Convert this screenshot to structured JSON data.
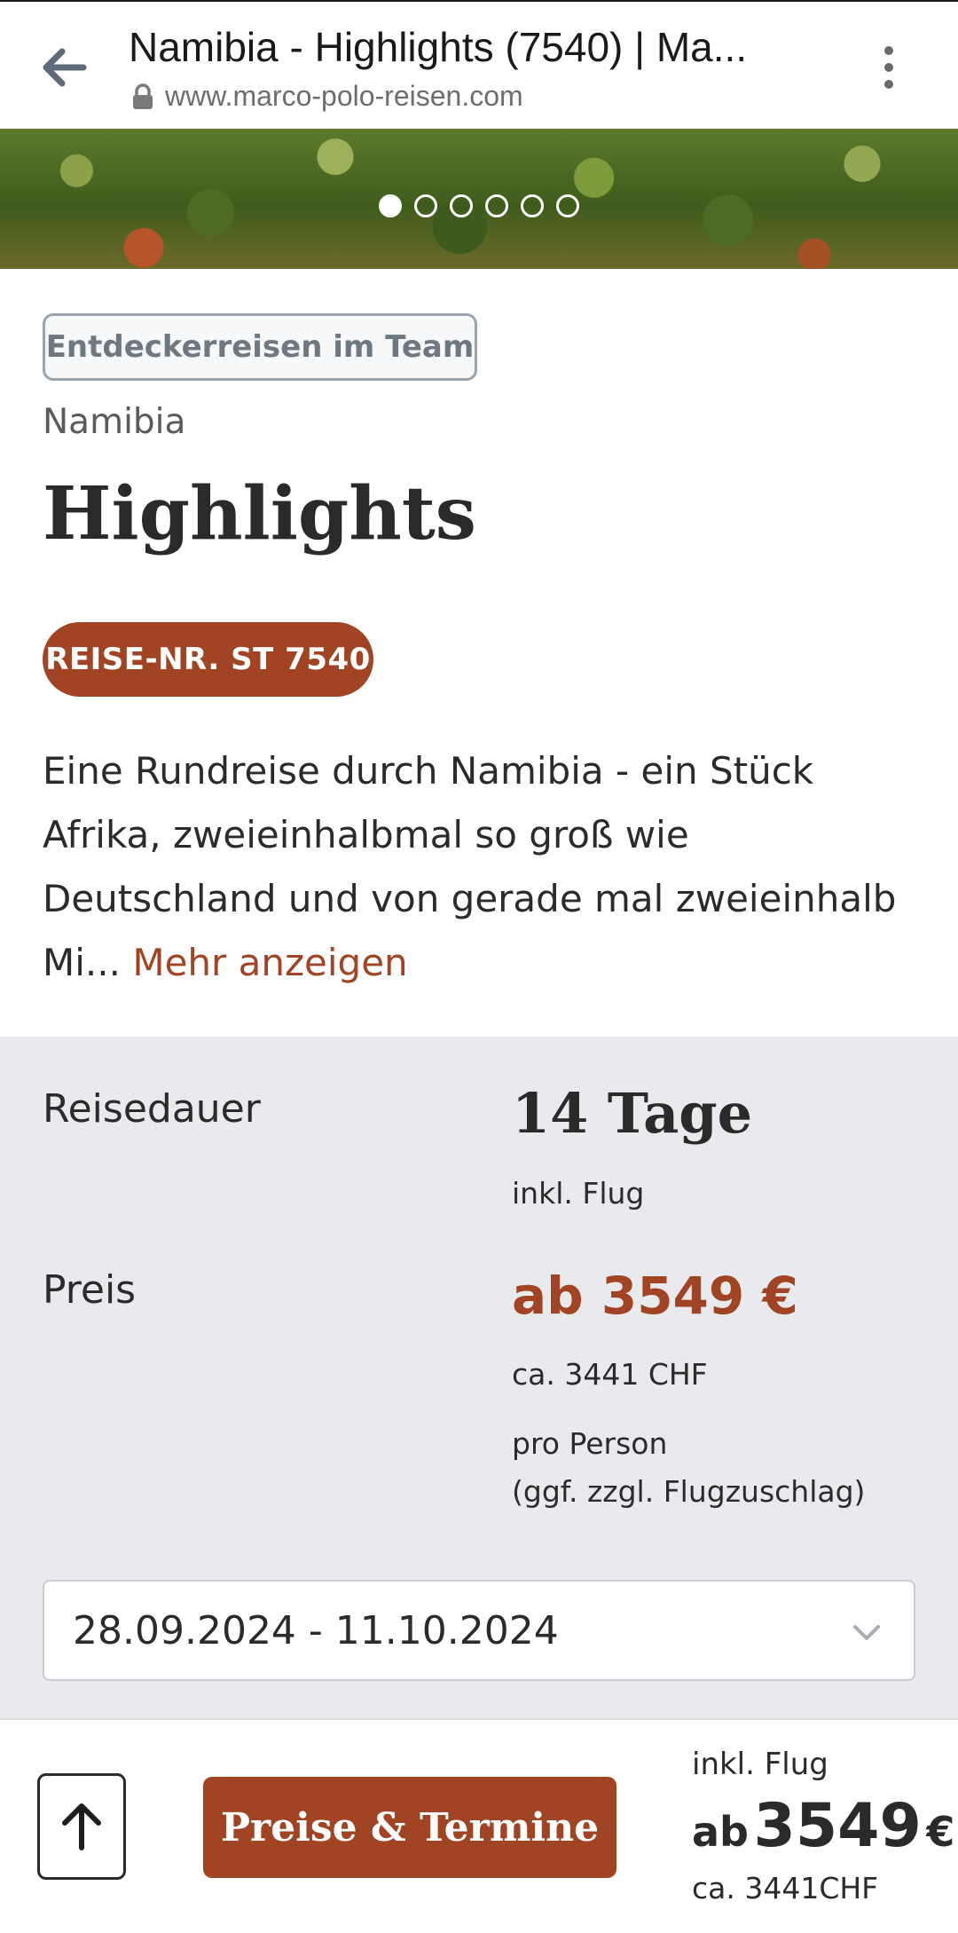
{
  "browser": {
    "page_title": "Namibia - Highlights (7540) | Ma...",
    "url": "www.marco-polo-reisen.com",
    "back_icon": "arrow-left-icon",
    "lock_icon": "lock-icon",
    "menu_icon": "more-vert-icon"
  },
  "hero": {
    "slide_count": 6,
    "active_slide": 1
  },
  "trip": {
    "tag": "Entdeckerreisen im Team",
    "country": "Namibia",
    "title": "Highlights",
    "trip_number": "REISE-NR. ST 7540",
    "description": "Eine Rundreise durch Namibia - ein Stück Afrika, zweieinhalbmal so groß wie Deutschland und von gerade mal zweieinhalb Mi...",
    "more_link": "Mehr anzeigen"
  },
  "info": {
    "duration_label": "Reisedauer",
    "duration_value": "14 Tage",
    "duration_note": "inkl. Flug",
    "price_label": "Preis",
    "price_value": "ab 3549 €",
    "price_chf": "ca. 3441 CHF",
    "price_note_1": "pro Person",
    "price_note_2": "(ggf. zzgl. Flugzuschlag)",
    "date_range": "28.09.2024 - 11.10.2024"
  },
  "bottom_bar": {
    "cta": "Preise & Termine",
    "inkl": "inkl. Flug",
    "ab": "ab",
    "price": "3549",
    "currency": "€",
    "chf": "ca. 3441CHF"
  },
  "colors": {
    "accent": "#a04423",
    "info_bg": "#e8eaed"
  }
}
